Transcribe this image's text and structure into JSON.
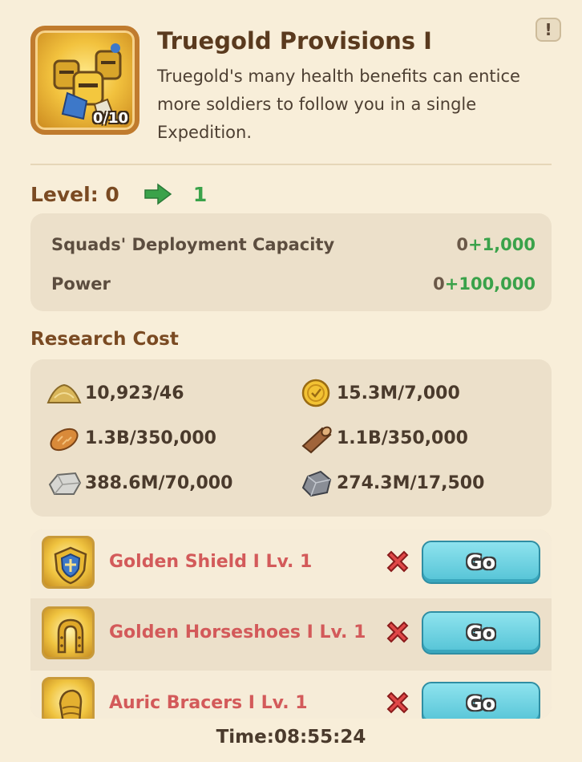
{
  "info_icon": "exclamation-icon",
  "research": {
    "title": "Truegold Provisions I",
    "description": "Truegold's many health benefits can entice more soldiers to follow you in a single Expedition.",
    "progress": "0/10",
    "icon": "knight-army-icon"
  },
  "level": {
    "label": "Level: 0",
    "next": "1",
    "arrow_icon": "green-arrow-icon"
  },
  "stats": [
    {
      "name": "Squads' Deployment Capacity",
      "base": "0",
      "bonus": "+1,000"
    },
    {
      "name": "Power",
      "base": "0",
      "bonus": "+100,000"
    }
  ],
  "cost": {
    "title": "Research Cost",
    "items": [
      {
        "icon": "sand-pile-icon",
        "text": "10,923/46"
      },
      {
        "icon": "gold-coin-icon",
        "text": "15.3M/7,000"
      },
      {
        "icon": "bread-icon",
        "text": "1.3B/350,000"
      },
      {
        "icon": "wood-log-icon",
        "text": "1.1B/350,000"
      },
      {
        "icon": "stone-icon",
        "text": "388.6M/70,000"
      },
      {
        "icon": "iron-ore-icon",
        "text": "274.3M/17,500"
      }
    ]
  },
  "requirements": [
    {
      "name": "Golden Shield I  Lv. 1",
      "icon": "golden-shield-icon",
      "status_icon": "red-x-icon",
      "button": "Go"
    },
    {
      "name": "Golden Horseshoes I  Lv. 1",
      "icon": "golden-horseshoe-icon",
      "status_icon": "red-x-icon",
      "button": "Go"
    },
    {
      "name": "Auric Bracers I  Lv. 1",
      "icon": "auric-bracer-icon",
      "status_icon": "red-x-icon",
      "button": "Go"
    }
  ],
  "timer": "Time:08:55:24",
  "colors": {
    "background": "#f8eed9",
    "accent_brown": "#7a4a22",
    "bonus_green": "#3aa24a",
    "requirement_red": "#d35a5a",
    "go_button": "#54c3d6"
  }
}
